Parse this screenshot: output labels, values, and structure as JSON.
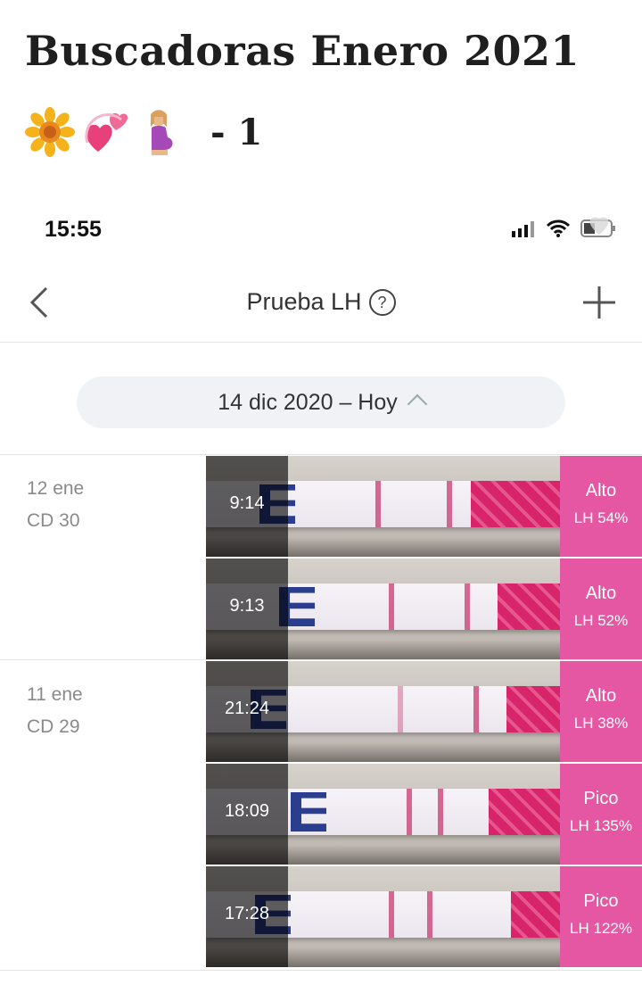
{
  "post": {
    "title": "Buscadoras Enero 2021",
    "subtitle_emojis": [
      "sunflower",
      "revolving-hearts",
      "pregnant-woman"
    ],
    "subtitle_suffix": "- 1"
  },
  "status_bar": {
    "time": "15:55",
    "icons": [
      "signal-icon",
      "wifi-icon",
      "battery-icon"
    ]
  },
  "nav": {
    "title": "Prueba LH",
    "help_glyph": "?",
    "back_icon": "chevron-left-icon",
    "add_icon": "plus-icon"
  },
  "date_range": {
    "label": "14 dic 2020 – Hoy",
    "icon": "chevron-up-icon"
  },
  "days": [
    {
      "date": "12 ene",
      "cycle_day": "CD 30"
    },
    {
      "date": "11 ene",
      "cycle_day": "CD 29"
    }
  ],
  "tests": [
    {
      "time": "9:14",
      "level": "Alto",
      "lh": "LH 54%"
    },
    {
      "time": "9:13",
      "level": "Alto",
      "lh": "LH 52%"
    },
    {
      "time": "21:24",
      "level": "Alto",
      "lh": "LH 38%"
    },
    {
      "time": "18:09",
      "level": "Pico",
      "lh": "LH 135%"
    },
    {
      "time": "17:28",
      "level": "Pico",
      "lh": "LH 122%"
    }
  ],
  "colors": {
    "result_panel": "#e657a3",
    "strip_handle": "#d8246b",
    "control_line": "#c83a70",
    "date_pill_bg": "#f1f2f5"
  }
}
